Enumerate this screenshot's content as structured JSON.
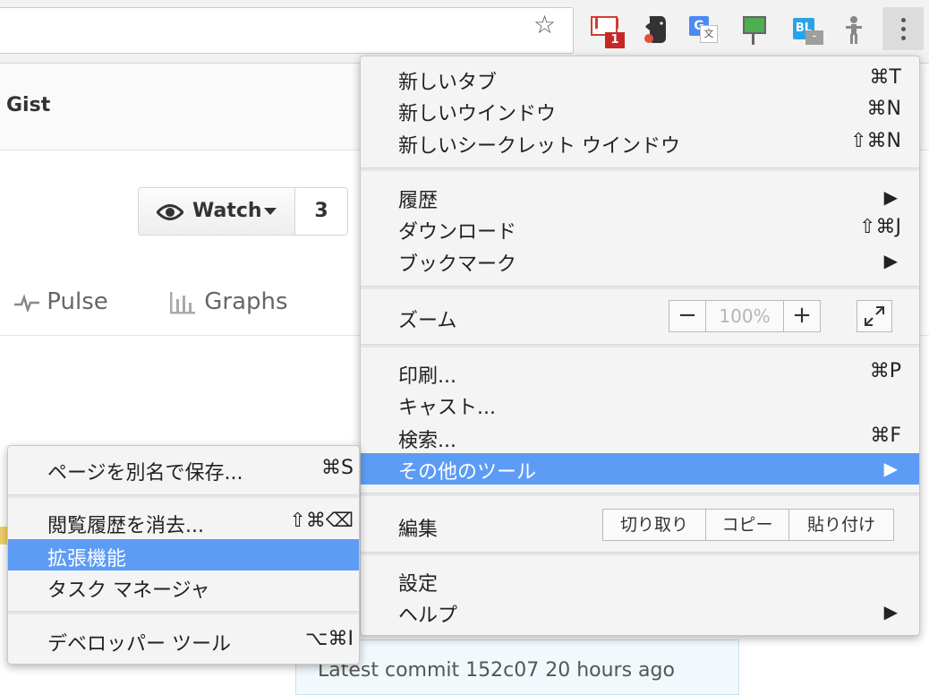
{
  "toolbar": {
    "gmail_badge": "1",
    "gtrans_g": "G",
    "gtrans_w": "文",
    "bl_label": "BL",
    "bl_badge": "-",
    "star_glyph": "☆"
  },
  "page": {
    "gist_label": "Gist",
    "watch_label": "Watch",
    "watch_count": "3",
    "tab_pulse": "Pulse",
    "tab_graphs": "Graphs",
    "commit_text": "Latest commit 152c07 20 hours ago"
  },
  "menu": {
    "new_tab": {
      "label": "新しいタブ",
      "shortcut": "⌘T"
    },
    "new_window": {
      "label": "新しいウインドウ",
      "shortcut": "⌘N"
    },
    "new_incognito": {
      "label": "新しいシークレット ウインドウ",
      "shortcut": "⇧⌘N"
    },
    "history": {
      "label": "履歴"
    },
    "downloads": {
      "label": "ダウンロード",
      "shortcut": "⇧⌘J"
    },
    "bookmarks": {
      "label": "ブックマーク"
    },
    "zoom": {
      "label": "ズーム",
      "minus": "−",
      "value": "100%",
      "plus": "+"
    },
    "print": {
      "label": "印刷...",
      "shortcut": "⌘P"
    },
    "cast": {
      "label": "キャスト..."
    },
    "find": {
      "label": "検索...",
      "shortcut": "⌘F"
    },
    "more_tools": {
      "label": "その他のツール"
    },
    "edit": {
      "label": "編集",
      "cut": "切り取り",
      "copy": "コピー",
      "paste": "貼り付け"
    },
    "settings": {
      "label": "設定"
    },
    "help": {
      "label": "ヘルプ"
    }
  },
  "submenu": {
    "save_page": {
      "label": "ページを別名で保存...",
      "shortcut": "⌘S"
    },
    "clear_history": {
      "label": "閲覧履歴を消去...",
      "shortcut": "⇧⌘⌫"
    },
    "extensions": {
      "label": "拡張機能"
    },
    "task_manager": {
      "label": "タスク マネージャ"
    },
    "dev_tools": {
      "label": "デベロッパー ツール",
      "shortcut": "⌥⌘I"
    }
  },
  "colors": {
    "highlight": "#5d9cf5",
    "menu_bg": "#f4f4f4",
    "gmail_red": "#d23f31"
  }
}
